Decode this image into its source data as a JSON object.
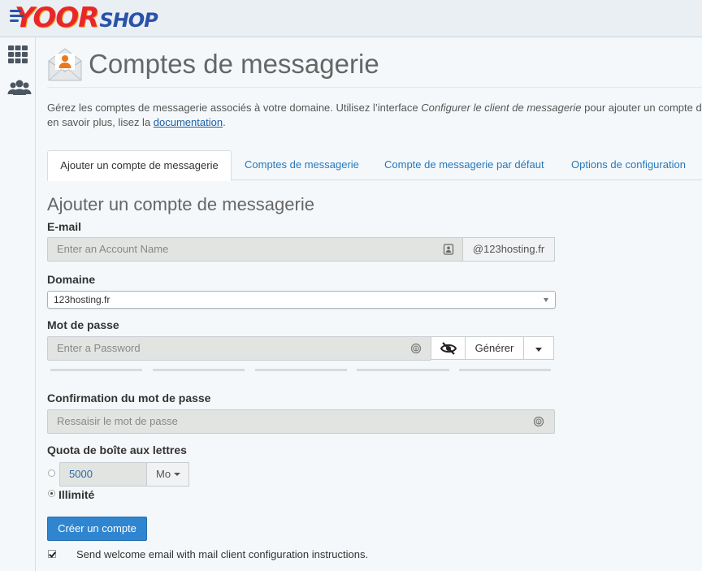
{
  "brand": {
    "logo_primary": "YOOR",
    "logo_secondary": "SHOP",
    "red": "#e8262b",
    "blue": "#2a52a8"
  },
  "sidebar": {
    "items": [
      {
        "icon": "grid-icon"
      },
      {
        "icon": "users-icon"
      }
    ]
  },
  "page": {
    "title": "Comptes de messagerie",
    "intro_1": "Gérez les comptes de messagerie associés à votre domaine. Utilisez l’interface ",
    "intro_em": "Configurer le client de messagerie",
    "intro_2": " pour ajouter un compte de",
    "intro_3": "en savoir plus, lisez la ",
    "intro_link": "documentation",
    "intro_4": "."
  },
  "tabs": [
    {
      "label": "Ajouter un compte de messagerie",
      "active": true
    },
    {
      "label": "Comptes de messagerie"
    },
    {
      "label": "Compte de messagerie par défaut"
    },
    {
      "label": "Options de configuration"
    }
  ],
  "form": {
    "section_title": "Ajouter un compte de messagerie",
    "email": {
      "label": "E-mail",
      "placeholder": "Enter an Account Name",
      "suffix": "@123hosting.fr"
    },
    "domain": {
      "label": "Domaine",
      "value": "123hosting.fr"
    },
    "password": {
      "label": "Mot de passe",
      "placeholder": "Enter a Password",
      "generate_label": "Générer"
    },
    "confirm": {
      "label": "Confirmation du mot de passe",
      "placeholder": "Ressaisir le mot de passe"
    },
    "quota": {
      "label": "Quota de boîte aux lettres",
      "value": "5000",
      "unit": "Mo",
      "unlimited_label": "Illimité",
      "selected": "unlimited"
    },
    "submit_label": "Créer un compte",
    "welcome_label": "Send welcome email with mail client configuration instructions.",
    "welcome_checked": true
  }
}
